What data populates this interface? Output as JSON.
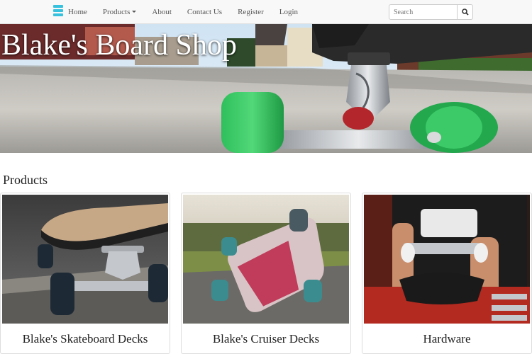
{
  "navbar": {
    "brand_icon": "layers-icon",
    "brand_color": "#36c2df",
    "links": [
      "Home",
      "Products",
      "About",
      "Contact Us",
      "Register",
      "Login"
    ],
    "search_placeholder": "Search",
    "search_icon": "search-icon"
  },
  "hero": {
    "title": "Blake's Board Shop"
  },
  "products": {
    "heading": "Products",
    "items": [
      {
        "title": "Blake's Skateboard Decks"
      },
      {
        "title": "Blake's Cruiser Decks"
      },
      {
        "title": "Hardware"
      }
    ]
  }
}
